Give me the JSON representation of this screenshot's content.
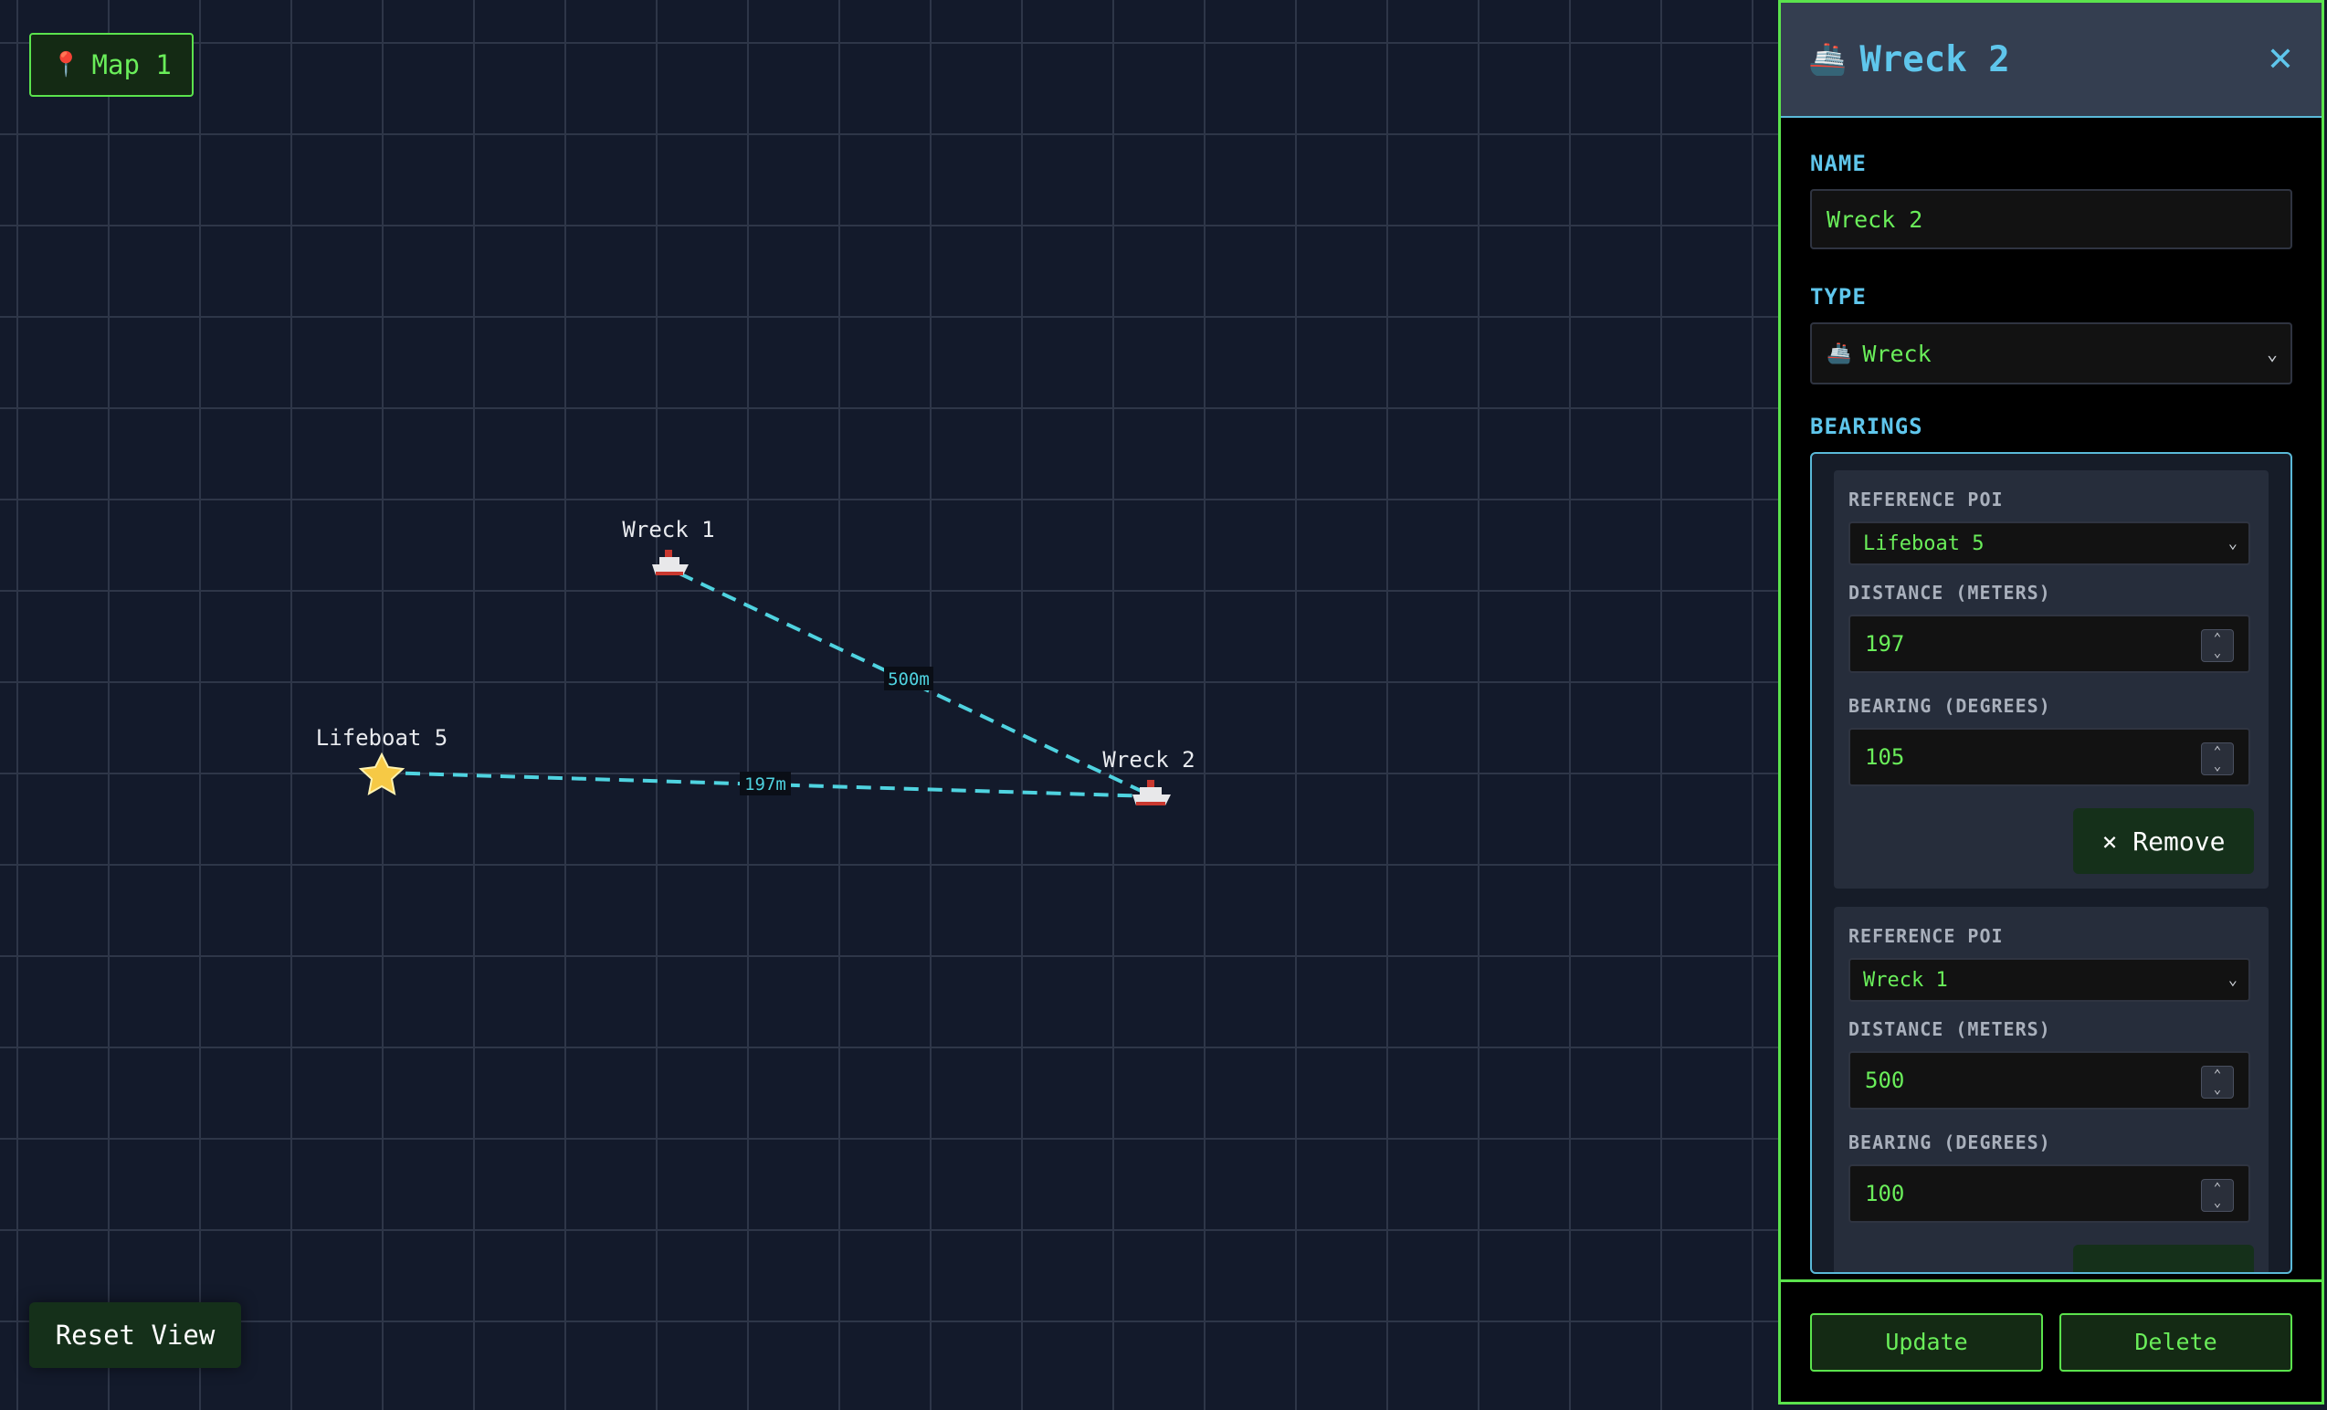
{
  "map": {
    "badge": {
      "icon": "map-pin-icon",
      "label": "Map 1"
    },
    "reset_label": "Reset View",
    "pois": [
      {
        "name": "Wreck 1",
        "icon": "ship-icon"
      },
      {
        "name": "Lifeboat 5",
        "icon": "star-icon"
      },
      {
        "name": "Wreck 2",
        "icon": "ship-icon"
      }
    ],
    "connections": [
      {
        "from": "Wreck 1",
        "to": "Wreck 2",
        "label": "500m"
      },
      {
        "from": "Lifeboat 5",
        "to": "Wreck 2",
        "label": "197m"
      }
    ],
    "colors": {
      "grid": "#2e3648",
      "line": "#4fd3e0",
      "background": "#131a2b"
    }
  },
  "panel": {
    "title": "Wreck 2",
    "close_icon": "close-icon",
    "name_label": "NAME",
    "name_value": "Wreck 2",
    "type_label": "TYPE",
    "type_value": "Wreck",
    "bearings_label": "BEARINGS",
    "bearings": [
      {
        "ref_label": "REFERENCE POI",
        "ref_value": "Lifeboat 5",
        "distance_label": "DISTANCE (METERS)",
        "distance_value": "197",
        "bearing_label": "BEARING (DEGREES)",
        "bearing_value": "105",
        "remove_label": "× Remove"
      },
      {
        "ref_label": "REFERENCE POI",
        "ref_value": "Wreck 1",
        "distance_label": "DISTANCE (METERS)",
        "distance_value": "500",
        "bearing_label": "BEARING (DEGREES)",
        "bearing_value": "100"
      }
    ],
    "update_label": "Update",
    "delete_label": "Delete",
    "colors": {
      "accent_green": "#5be34d",
      "accent_blue": "#5fc6ec"
    }
  }
}
